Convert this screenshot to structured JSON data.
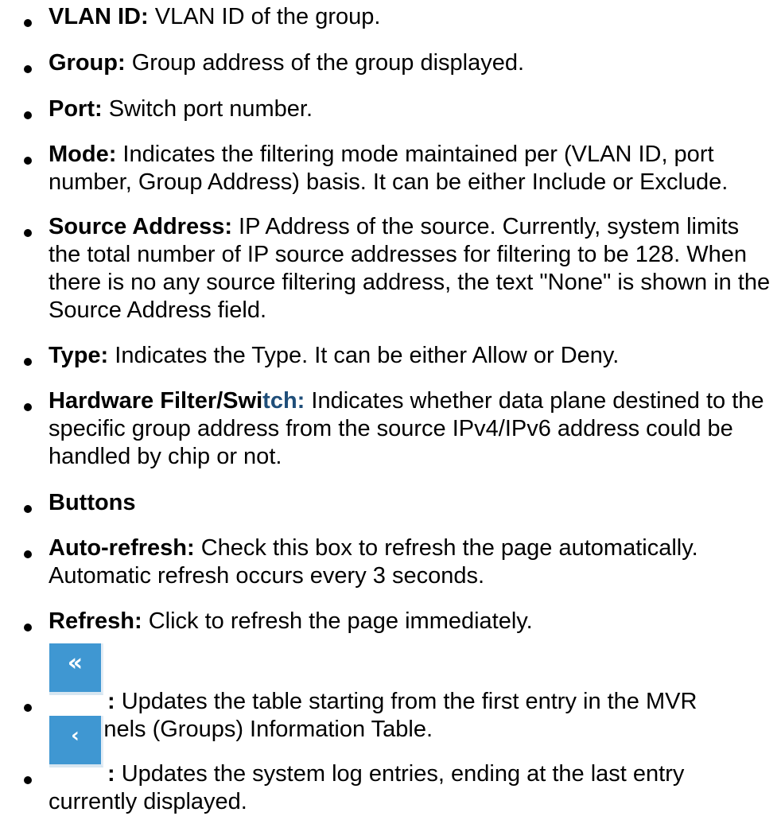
{
  "items": [
    {
      "term": "VLAN ID:",
      "text": " VLAN ID of the group."
    },
    {
      "term": "Group:",
      "text": " Group address of the group displayed."
    },
    {
      "term": "Port:",
      "text": " Switch port number."
    },
    {
      "term": "Mode:",
      "text": " Indicates the filtering mode maintained per (VLAN ID, port number, Group Address) basis. It can be either Include or Exclude."
    },
    {
      "term": "Source Address:",
      "text": " IP Address of the source. Currently, system limits the total number of IP source addresses for filtering to be 128. When there is no any source filtering address, the text \"None\" is shown in the Source Address field."
    },
    {
      "term": "Type:",
      "text": " Indicates the Type. It can be either Allow or Deny."
    },
    {
      "term_start": "Hardware Filter/Swi",
      "term_end": "tch:",
      "text": " Indicates whether data plane destined to the specific group address from the source IPv4/IPv6 address could be handled by chip or not."
    },
    {
      "term": "Buttons"
    },
    {
      "term": "Auto-refresh:",
      "text": " Check this box to refresh the page automatically. Automatic refresh occurs every 3 seconds."
    },
    {
      "term": "Refresh:",
      "text": " Click to refresh the page immediately."
    },
    {
      "icon": "double-chevron-left-icon",
      "glyph": "«",
      "term": ":",
      "text": " Updates the table starting from the first entry in the MVR Channels (Groups) Information Table."
    },
    {
      "icon": "chevron-left-icon",
      "glyph": "‹",
      "term": ":",
      "text": " Updates the system log entries, ending at the last entry currently displayed."
    }
  ],
  "colors": {
    "button_blue": "#3f97d2",
    "term_tail_blue": "#1f4e79",
    "text": "#000000"
  }
}
